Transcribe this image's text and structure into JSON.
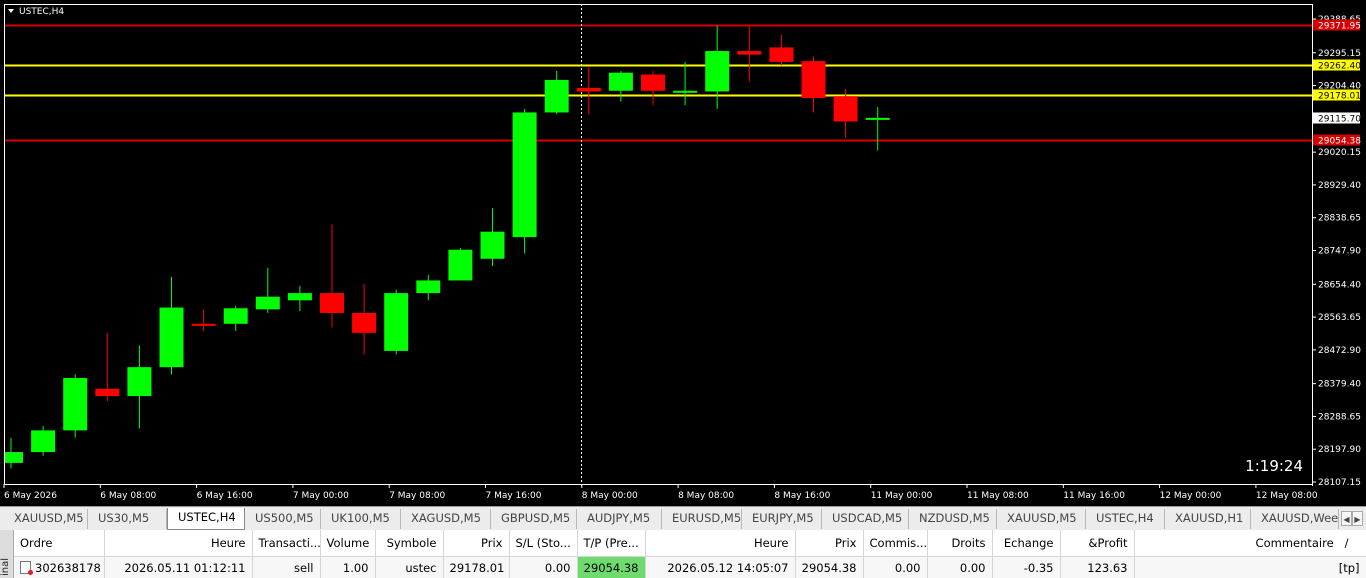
{
  "chart": {
    "symbol_title": "USTEC,H4",
    "countdown": "1:19:24",
    "price_scale": [
      "29388.65",
      "29295.15",
      "29204.40",
      "29115.70",
      "29020.15",
      "28929.40",
      "28838.65",
      "28747.90",
      "28654.40",
      "28563.65",
      "28472.90",
      "28379.40",
      "28288.65",
      "28197.90",
      "28107.15"
    ],
    "time_labels": [
      "6 May 2026",
      "6 May 08:00",
      "6 May 16:00",
      "7 May 00:00",
      "7 May 08:00",
      "7 May 16:00",
      "8 May 00:00",
      "8 May 08:00",
      "8 May 16:00",
      "11 May 00:00",
      "11 May 08:00",
      "11 May 16:00",
      "12 May 00:00",
      "12 May 08:00"
    ],
    "level_lines": [
      {
        "price": 29371.95,
        "label": "29371.95",
        "color": "#d40000"
      },
      {
        "price": 29262.4,
        "label": "29262.40",
        "color": "#ffff00"
      },
      {
        "price": 29178.01,
        "label": "29178.01",
        "color": "#ffff00"
      },
      {
        "price": 29054.38,
        "label": "29054.38",
        "color": "#d40000"
      }
    ],
    "current_price": "29115.70",
    "colors": {
      "bull": "#00ff00",
      "bear": "#ff0000",
      "background": "#000000",
      "text": "#ffffff"
    }
  },
  "chart_data": {
    "type": "candlestick",
    "title": "USTEC,H4",
    "ylim": [
      28107.15,
      29388.65
    ],
    "x": [
      "6 May 2026",
      "",
      "",
      "6 May 08:00",
      "",
      "",
      "6 May 16:00",
      "",
      "",
      "7 May 00:00",
      "",
      "",
      "7 May 08:00",
      "",
      "",
      "7 May 16:00",
      "",
      "",
      "8 May 00:00",
      "",
      "",
      "8 May 08:00",
      "",
      "",
      "8 May 16:00",
      "",
      "",
      "11 May 00:00",
      "",
      "",
      "11 May 08:00",
      "",
      "",
      "11 May 16:00",
      "",
      "",
      "12 May 00:00",
      "",
      "",
      "12 May 08:00",
      ""
    ],
    "candles": [
      {
        "o": 28160,
        "h": 28230,
        "l": 28145,
        "c": 28190
      },
      {
        "o": 28190,
        "h": 28262,
        "l": 28180,
        "c": 28250
      },
      {
        "o": 28250,
        "h": 28405,
        "l": 28230,
        "c": 28395
      },
      {
        "o": 28365,
        "h": 28520,
        "l": 28330,
        "c": 28345
      },
      {
        "o": 28345,
        "h": 28485,
        "l": 28255,
        "c": 28425
      },
      {
        "o": 28425,
        "h": 28675,
        "l": 28405,
        "c": 28590
      },
      {
        "o": 28545,
        "h": 28585,
        "l": 28525,
        "c": 28540
      },
      {
        "o": 28545,
        "h": 28595,
        "l": 28525,
        "c": 28588
      },
      {
        "o": 28585,
        "h": 28700,
        "l": 28575,
        "c": 28620
      },
      {
        "o": 28610,
        "h": 28650,
        "l": 28580,
        "c": 28630
      },
      {
        "o": 28630,
        "h": 28820,
        "l": 28535,
        "c": 28575
      },
      {
        "o": 28575,
        "h": 28655,
        "l": 28460,
        "c": 28520
      },
      {
        "o": 28470,
        "h": 28640,
        "l": 28460,
        "c": 28630
      },
      {
        "o": 28630,
        "h": 28680,
        "l": 28610,
        "c": 28665
      },
      {
        "o": 28665,
        "h": 28755,
        "l": 28665,
        "c": 28750
      },
      {
        "o": 28725,
        "h": 28865,
        "l": 28705,
        "c": 28800
      },
      {
        "o": 28785,
        "h": 29140,
        "l": 28740,
        "c": 29130
      },
      {
        "o": 29130,
        "h": 29245,
        "l": 29125,
        "c": 29220
      },
      {
        "o": 29198,
        "h": 29255,
        "l": 29125,
        "c": 29188
      },
      {
        "o": 29190,
        "h": 29245,
        "l": 29160,
        "c": 29240
      },
      {
        "o": 29235,
        "h": 29245,
        "l": 29150,
        "c": 29190
      },
      {
        "o": 29188,
        "h": 29270,
        "l": 29150,
        "c": 29190
      },
      {
        "o": 29188,
        "h": 29370,
        "l": 29140,
        "c": 29300
      },
      {
        "o": 29300,
        "h": 29370,
        "l": 29215,
        "c": 29290
      },
      {
        "o": 29310,
        "h": 29345,
        "l": 29260,
        "c": 29270
      },
      {
        "o": 29272,
        "h": 29285,
        "l": 29130,
        "c": 29170
      },
      {
        "o": 29175,
        "h": 29195,
        "l": 29060,
        "c": 29105
      },
      {
        "o": 29110,
        "h": 29145,
        "l": 29025,
        "c": 29115
      }
    ]
  },
  "tabs": [
    "XAUUSD,M5",
    "US30,M5",
    "USTEC,H4",
    "US500,M5",
    "UK100,M5",
    "XAGUSD,M5",
    "GBPUSD,M5",
    "AUDJPY,M5",
    "EURUSD,M5",
    "EURJPY,M5",
    "USDCAD,M5",
    "NZDUSD,M5",
    "XAUUSD,M5",
    "USTEC,H4",
    "XAUUSD,H1",
    "XAUUSD,Weekl"
  ],
  "active_tab": "USTEC,H4",
  "terminal": {
    "side_label": "inal",
    "columns": [
      "Ordre",
      "Heure",
      "Transacti...",
      "Volume",
      "Symbole",
      "Prix",
      "S/L (Sto...",
      "T/P (Pre...",
      "Heure",
      "Prix",
      "Commis...",
      "Droits",
      "Echange",
      "&Profit",
      "Commentaire"
    ],
    "sort_indicator": "/",
    "rows": [
      {
        "order": "302638178",
        "open_time": "2026.05.11 01:12:11",
        "type": "sell",
        "volume": "1.00",
        "symbol": "ustec",
        "price": "29178.01",
        "sl": "0.00",
        "tp": "29054.38",
        "close_time": "2026.05.12 14:05:07",
        "close_price": "29054.38",
        "commission": "0.00",
        "fees": "0.00",
        "swap": "-0.35",
        "profit": "123.63",
        "comment": "[tp]"
      }
    ]
  }
}
